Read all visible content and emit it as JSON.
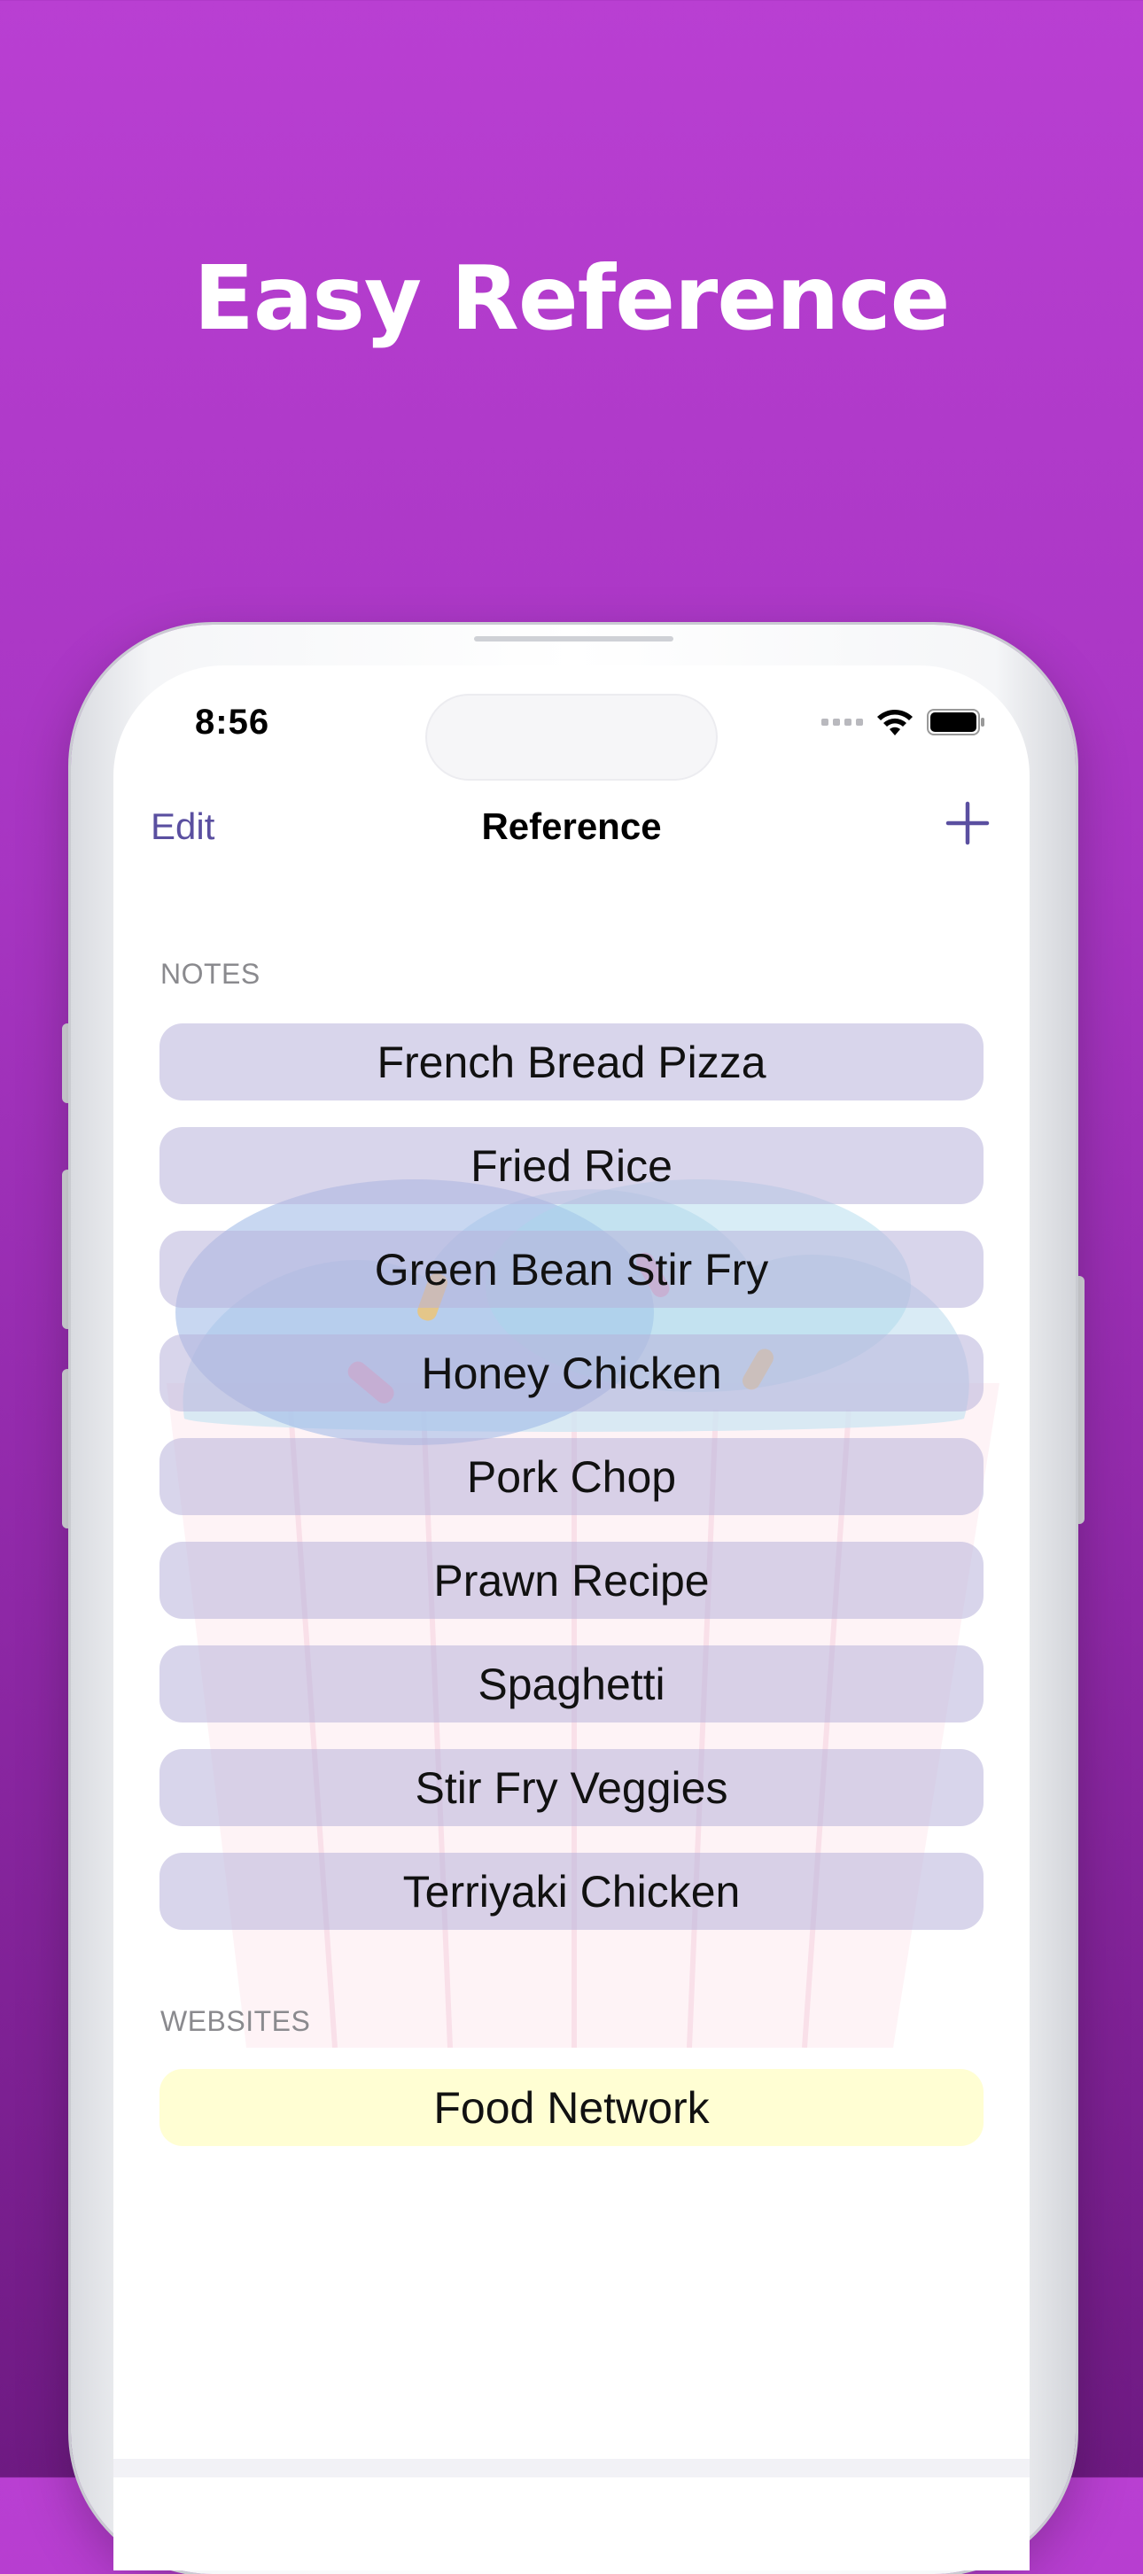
{
  "headline": "Easy Reference",
  "status_bar": {
    "time": "8:56"
  },
  "nav": {
    "edit_label": "Edit",
    "title": "Reference",
    "add_icon": "plus-icon"
  },
  "sections": {
    "notes": {
      "header": "NOTES",
      "items": [
        {
          "label": "French Bread Pizza"
        },
        {
          "label": "Fried Rice"
        },
        {
          "label": "Green Bean Stir Fry"
        },
        {
          "label": "Honey Chicken"
        },
        {
          "label": "Pork Chop"
        },
        {
          "label": "Prawn Recipe"
        },
        {
          "label": "Spaghetti"
        },
        {
          "label": "Stir Fry Veggies"
        },
        {
          "label": "Terriyaki Chicken"
        }
      ]
    },
    "websites": {
      "header": "WEBSITES",
      "items": [
        {
          "label": "Food Network"
        }
      ]
    }
  },
  "colors": {
    "background_top": "#b93fd2",
    "background_bottom": "#6e1a82",
    "accent": "#5a4fa0",
    "note_row": "#d6d2ec",
    "website_row": "#fffcd0"
  }
}
